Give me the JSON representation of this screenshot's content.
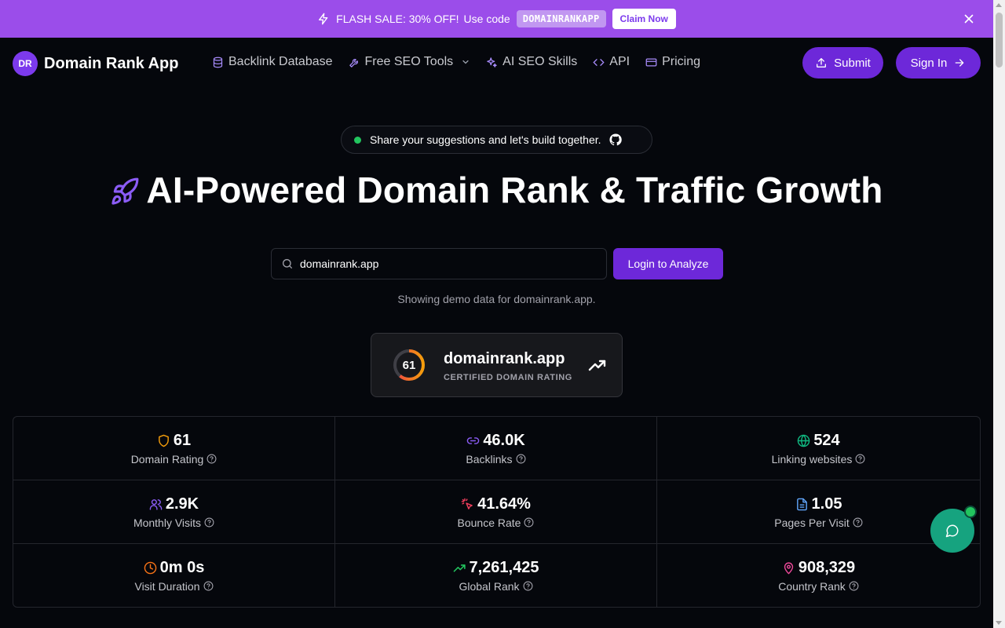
{
  "banner": {
    "sale_text": "FLASH SALE: 30% OFF!",
    "use_code": "Use code",
    "code": "DOMAINRANKAPP",
    "claim_label": "Claim Now"
  },
  "nav": {
    "logo_badge": "DR",
    "logo_name": "Domain Rank App",
    "items": [
      {
        "label": "Backlink Database"
      },
      {
        "label": "Free SEO Tools"
      },
      {
        "label": "AI SEO Skills"
      },
      {
        "label": "API"
      },
      {
        "label": "Pricing"
      }
    ],
    "submit_label": "Submit",
    "signin_label": "Sign In"
  },
  "pill": {
    "text": "Share your suggestions and let's build together."
  },
  "hero": {
    "title": "AI-Powered Domain Rank & Traffic Growth"
  },
  "search": {
    "value": "domainrank.app",
    "button_label": "Login to Analyze",
    "demo_note": "Showing demo data for domainrank.app."
  },
  "card": {
    "rating": "61",
    "rating_fraction": 0.61,
    "domain": "domainrank.app",
    "subtitle": "CERTIFIED DOMAIN RATING"
  },
  "stats": [
    {
      "value": "61",
      "label": "Domain Rating",
      "icon": "shield-icon",
      "color": "#f59e0b"
    },
    {
      "value": "46.0K",
      "label": "Backlinks",
      "icon": "link-icon",
      "color": "#8b5cf6"
    },
    {
      "value": "524",
      "label": "Linking websites",
      "icon": "globe-icon",
      "color": "#10b981"
    },
    {
      "value": "2.9K",
      "label": "Monthly Visits",
      "icon": "users-icon",
      "color": "#8b5cf6"
    },
    {
      "value": "41.64%",
      "label": "Bounce Rate",
      "icon": "pointer-icon",
      "color": "#f43f5e"
    },
    {
      "value": "1.05",
      "label": "Pages Per Visit",
      "icon": "file-icon",
      "color": "#60a5fa"
    },
    {
      "value": "0m 0s",
      "label": "Visit Duration",
      "icon": "clock-icon",
      "color": "#f97316"
    },
    {
      "value": "7,261,425",
      "label": "Global Rank",
      "icon": "trending-up-icon",
      "color": "#22c55e"
    },
    {
      "value": "908,329",
      "label": "Country Rank",
      "icon": "map-pin-icon",
      "color": "#ec4899"
    }
  ],
  "colors": {
    "accent": "#6d28d9",
    "banner": "#9b4dea",
    "background": "#05070c",
    "chat": "#16a37f"
  }
}
